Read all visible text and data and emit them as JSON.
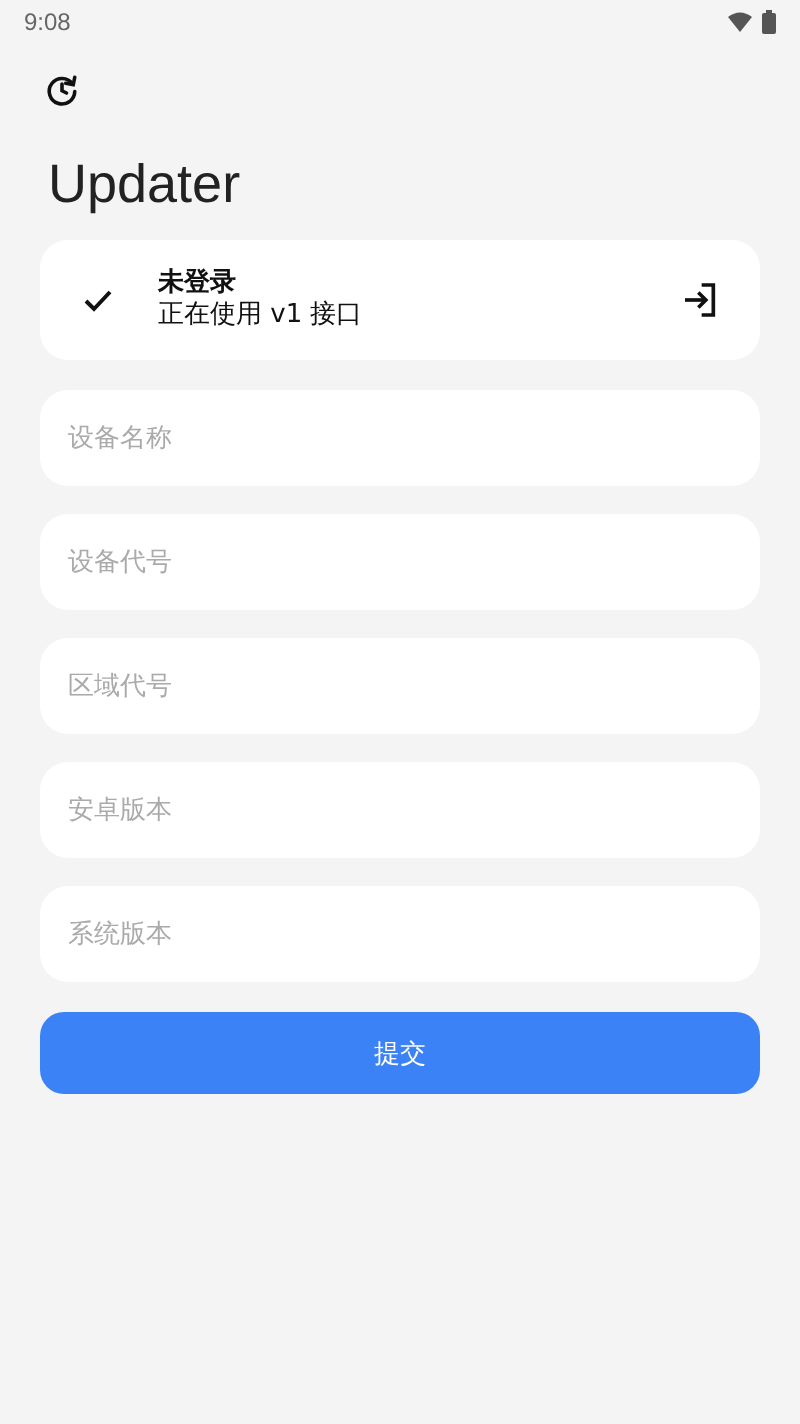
{
  "status_bar": {
    "time": "9:08"
  },
  "title": "Updater",
  "account": {
    "checked": true,
    "status": "未登录",
    "detail": "正在使用 v1 接口"
  },
  "fields": [
    {
      "placeholder": "设备名称"
    },
    {
      "placeholder": "设备代号"
    },
    {
      "placeholder": "区域代号"
    },
    {
      "placeholder": "安卓版本"
    },
    {
      "placeholder": "系统版本"
    }
  ],
  "submit": "提交"
}
